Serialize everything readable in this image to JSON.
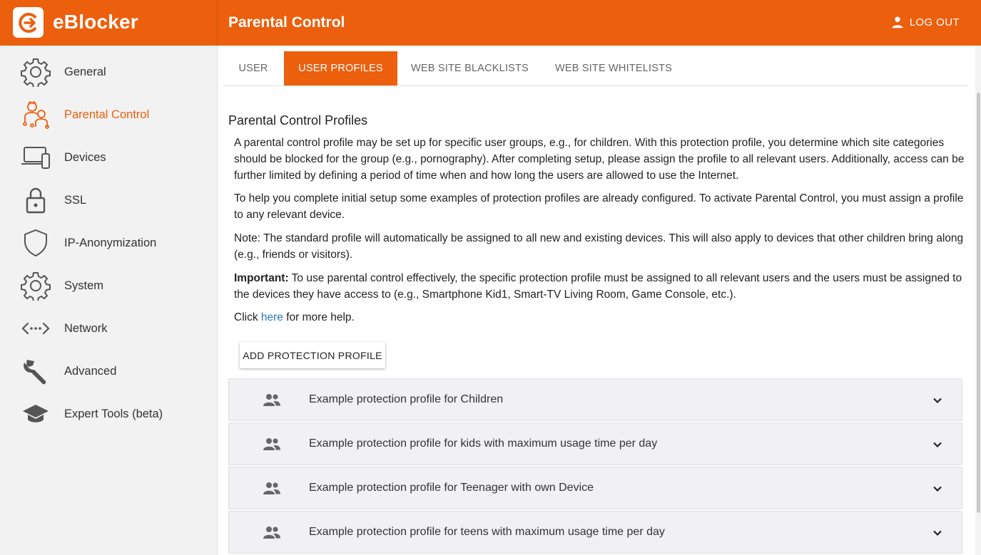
{
  "app": {
    "brand_name": "eBlocker",
    "page_title": "Parental Control",
    "logout_label": "LOG OUT",
    "accent_color": "#ec5f0c"
  },
  "sidebar": {
    "items": [
      {
        "label": "General",
        "icon": "gear-icon",
        "active": false
      },
      {
        "label": "Parental Control",
        "icon": "family-icon",
        "active": true
      },
      {
        "label": "Devices",
        "icon": "devices-icon",
        "active": false
      },
      {
        "label": "SSL",
        "icon": "lock-icon",
        "active": false
      },
      {
        "label": "IP-Anonymization",
        "icon": "shield-icon",
        "active": false
      },
      {
        "label": "System",
        "icon": "gear-icon",
        "active": false
      },
      {
        "label": "Network",
        "icon": "network-icon",
        "active": false
      },
      {
        "label": "Advanced",
        "icon": "wrench-icon",
        "active": false
      },
      {
        "label": "Expert Tools (beta)",
        "icon": "graduation-cap-icon",
        "active": false
      }
    ]
  },
  "tabs": [
    {
      "label": "USER",
      "active": false
    },
    {
      "label": "USER PROFILES",
      "active": true
    },
    {
      "label": "WEB SITE BLACKLISTS",
      "active": false
    },
    {
      "label": "WEB SITE WHITELISTS",
      "active": false
    }
  ],
  "content": {
    "section_title": "Parental Control Profiles",
    "para1": "A parental control profile may be set up for specific user groups, e.g., for children. With this protection profile, you determine which site categories should be blocked for the group (e.g., pornography). After completing setup, please assign the profile to all relevant users. Additionally, access can be further limited by defining a period of time when and how long the users are allowed to use the Internet.",
    "para2": "To help you complete initial setup some examples of protection profiles are already configured. To activate Parental Control, you must assign a profile to any relevant device.",
    "para3": "Note: The standard profile will automatically be assigned to all new and existing devices. This will also apply to devices that other children bring along (e.g., friends or visitors).",
    "important_label": "Important:",
    "important_text": " To use parental control effectively, the specific protection profile must be assigned to all relevant users and the users must be assigned to the devices they have access to (e.g., Smartphone Kid1, Smart-TV Living Room, Game Console, etc.).",
    "help_prefix": "Click ",
    "help_link": "here",
    "help_suffix": " for more help.",
    "add_button_label": "ADD PROTECTION PROFILE"
  },
  "profiles": [
    {
      "name": "Example protection profile for Children",
      "icon": "group-icon"
    },
    {
      "name": "Example protection profile for kids with maximum usage time per day",
      "icon": "group-icon"
    },
    {
      "name": "Example protection profile for Teenager with own Device",
      "icon": "group-icon"
    },
    {
      "name": "Example protection profile for teens with maximum usage time per day",
      "icon": "group-icon"
    }
  ]
}
